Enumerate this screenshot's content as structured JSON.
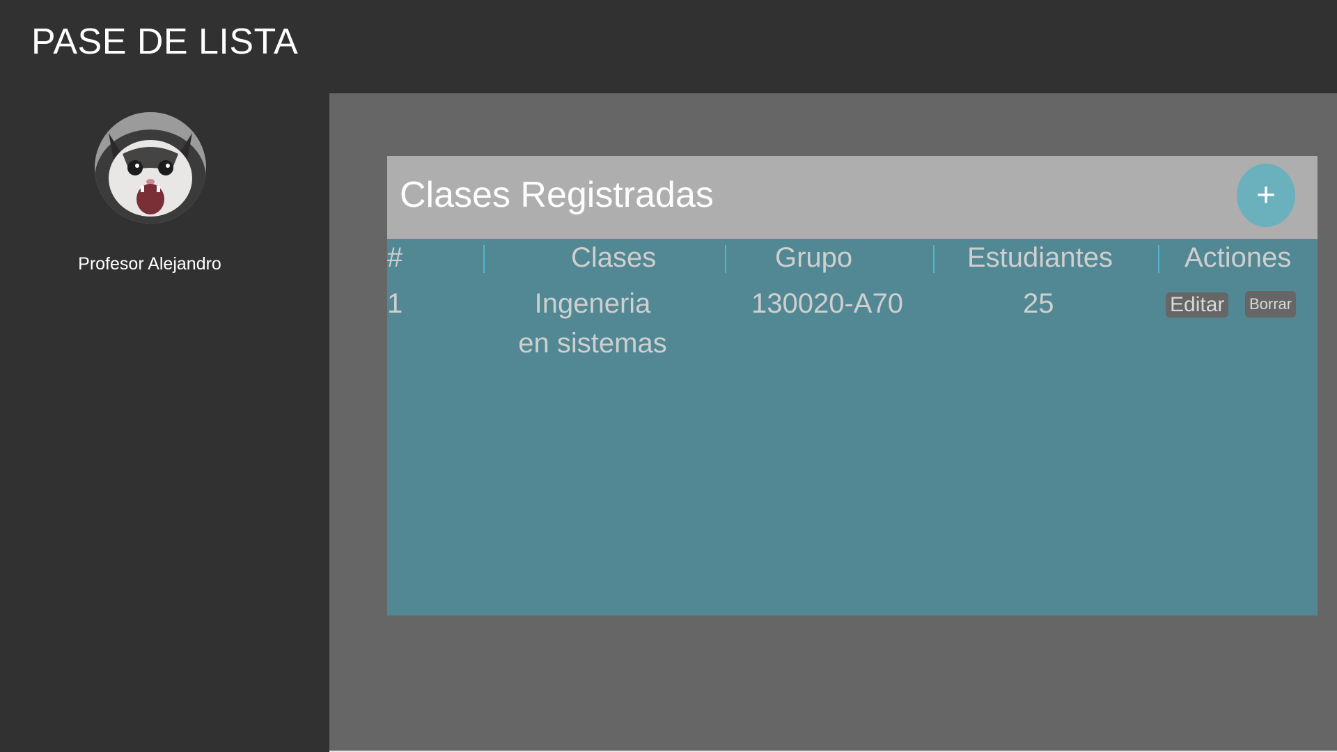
{
  "app": {
    "title": "PASE DE LISTA"
  },
  "profile": {
    "name": "Profesor Alejandro",
    "avatar_icon": "cat-avatar-photo"
  },
  "classes_card": {
    "title": "Clases Registradas",
    "add_label": "+",
    "columns": [
      "#",
      "Clases",
      "Grupo",
      "Estudiantes",
      "Actiones"
    ],
    "rows": [
      {
        "number": "1",
        "class_line1": "Ingeneria",
        "class_line2": "en sistemas",
        "group": "130020-A70",
        "students": "25",
        "edit_label": "Editar",
        "delete_label": "Borrar"
      }
    ]
  },
  "colors": {
    "background_dark": "#313131",
    "main_panel": "#666666",
    "card_header": "#afaeae",
    "table_body": "#518893",
    "accent_button": "#6ab0bd",
    "header_separator": "#4fb8cc"
  }
}
